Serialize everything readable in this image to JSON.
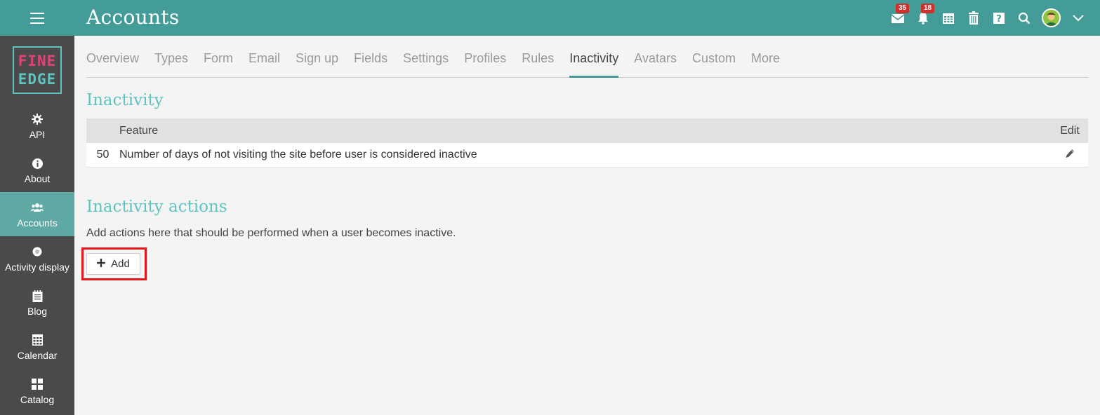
{
  "header": {
    "title": "Accounts",
    "mail_badge": "35",
    "notif_badge": "18",
    "icons": [
      "mail-icon",
      "bell-icon",
      "calendar-icon",
      "trash-icon",
      "help-icon",
      "search-icon",
      "avatar",
      "chevron-down-icon"
    ]
  },
  "logo": {
    "line1": "FINE",
    "line2": "EDGE"
  },
  "sidebar": {
    "items": [
      {
        "label": "API",
        "icon": "gear-icon"
      },
      {
        "label": "About",
        "icon": "info-icon"
      },
      {
        "label": "Accounts",
        "icon": "users-icon",
        "active": true
      },
      {
        "label": "Activity display",
        "icon": "radio-icon"
      },
      {
        "label": "Blog",
        "icon": "blog-icon"
      },
      {
        "label": "Calendar",
        "icon": "calendar-icon"
      },
      {
        "label": "Catalog",
        "icon": "grid-icon"
      }
    ]
  },
  "tabs": [
    {
      "label": "Overview"
    },
    {
      "label": "Types"
    },
    {
      "label": "Form"
    },
    {
      "label": "Email"
    },
    {
      "label": "Sign up"
    },
    {
      "label": "Fields"
    },
    {
      "label": "Settings"
    },
    {
      "label": "Profiles"
    },
    {
      "label": "Rules"
    },
    {
      "label": "Inactivity",
      "active": true
    },
    {
      "label": "Avatars"
    },
    {
      "label": "Custom"
    },
    {
      "label": "More"
    }
  ],
  "inactivity": {
    "heading": "Inactivity",
    "columns": {
      "feature": "Feature",
      "edit": "Edit"
    },
    "rows": [
      {
        "value": "50",
        "feature": "Number of days of not visiting the site before user is considered inactive"
      }
    ]
  },
  "actions": {
    "heading": "Inactivity actions",
    "description": "Add actions here that should be performed when a user becomes inactive.",
    "add_label": "Add"
  },
  "colors": {
    "accent": "#449c99",
    "heading": "#5fc4c1",
    "sidebar": "#4a4a4a",
    "badge": "#d0302c",
    "highlight": "#e3161c"
  }
}
